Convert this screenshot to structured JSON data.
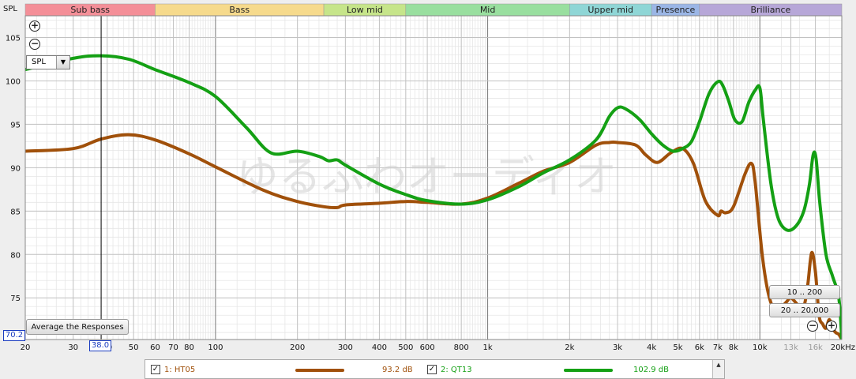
{
  "header": {
    "spl_label": "SPL"
  },
  "controls": {
    "spl_selected": "SPL",
    "average_button": "Average the Responses",
    "range_10_200": "10 .. 200",
    "range_20_20000": "20 .. 20,000",
    "cursor_freq": "38.0",
    "cursor_level": "70.2"
  },
  "bands": [
    {
      "name": "Sub bass",
      "from": 20,
      "to": 60,
      "color": "#f48f98"
    },
    {
      "name": "Bass",
      "from": 60,
      "to": 250,
      "color": "#f6da8c"
    },
    {
      "name": "Low mid",
      "from": 250,
      "to": 500,
      "color": "#c6e58a"
    },
    {
      "name": "Mid",
      "from": 500,
      "to": 2000,
      "color": "#99df9f"
    },
    {
      "name": "Upper mid",
      "from": 2000,
      "to": 4000,
      "color": "#8fd6d6"
    },
    {
      "name": "Presence",
      "from": 4000,
      "to": 6000,
      "color": "#9bb6e6"
    },
    {
      "name": "Brilliance",
      "from": 6000,
      "to": 20000,
      "color": "#b7a7d8"
    }
  ],
  "legend": [
    {
      "index": "1: HT05",
      "level": "93.2 dB",
      "color": "#a0500a"
    },
    {
      "index": "2: QT13",
      "level": "102.9 dB",
      "color": "#14a014"
    }
  ],
  "watermark": "ゆるふわオーディオ",
  "chart_data": {
    "type": "line",
    "xlabel": "",
    "ylabel": "SPL",
    "xscale": "log",
    "xlim": [
      20,
      20000
    ],
    "ylim": [
      70.2,
      107.5
    ],
    "grid": true,
    "cursor_x": 38,
    "x_ticks": [
      {
        "v": 20,
        "t": "20"
      },
      {
        "v": 30,
        "t": "30"
      },
      {
        "v": 40,
        "t": "40"
      },
      {
        "v": 50,
        "t": "50"
      },
      {
        "v": 60,
        "t": "60"
      },
      {
        "v": 70,
        "t": "70"
      },
      {
        "v": 80,
        "t": "80"
      },
      {
        "v": 100,
        "t": "100"
      },
      {
        "v": 200,
        "t": "200"
      },
      {
        "v": 300,
        "t": "300"
      },
      {
        "v": 400,
        "t": "400"
      },
      {
        "v": 500,
        "t": "500"
      },
      {
        "v": 600,
        "t": "600"
      },
      {
        "v": 800,
        "t": "800"
      },
      {
        "v": 1000,
        "t": "1k"
      },
      {
        "v": 2000,
        "t": "2k"
      },
      {
        "v": 3000,
        "t": "3k"
      },
      {
        "v": 4000,
        "t": "4k"
      },
      {
        "v": 5000,
        "t": "5k"
      },
      {
        "v": 6000,
        "t": "6k"
      },
      {
        "v": 7000,
        "t": "7k"
      },
      {
        "v": 8000,
        "t": "8k"
      },
      {
        "v": 10000,
        "t": "10k"
      },
      {
        "v": 13000,
        "t": "13k"
      },
      {
        "v": 16000,
        "t": "16k"
      },
      {
        "v": 20000,
        "t": "20kHz"
      }
    ],
    "y_ticks": [
      75,
      80,
      85,
      90,
      95,
      100,
      105
    ],
    "series": [
      {
        "name": "1: HT05",
        "color": "#a0500a",
        "x": [
          20,
          30,
          38,
          48,
          60,
          80,
          100,
          150,
          200,
          250,
          280,
          300,
          400,
          500,
          600,
          800,
          1000,
          1300,
          1600,
          2000,
          2500,
          2800,
          3000,
          3500,
          3800,
          4200,
          4700,
          5200,
          5700,
          6300,
          7000,
          7200,
          7500,
          8000,
          8800,
          9300,
          9600,
          10200,
          10800,
          11500,
          12500,
          13000,
          13800,
          14500,
          15000,
          15500,
          16000,
          16500,
          17000,
          17500,
          18000,
          18500,
          19000,
          19500,
          20000
        ],
        "y": [
          91.9,
          92.2,
          93.3,
          93.8,
          93.2,
          91.6,
          90.1,
          87.4,
          86.1,
          85.5,
          85.4,
          85.7,
          85.9,
          86.1,
          86.0,
          85.8,
          86.5,
          88.2,
          89.6,
          90.6,
          92.6,
          92.9,
          92.9,
          92.6,
          91.5,
          90.6,
          91.7,
          92.2,
          90.5,
          86.2,
          84.5,
          85.0,
          84.8,
          85.5,
          89.2,
          90.5,
          88.5,
          80.0,
          75.2,
          73.5,
          74.5,
          75.0,
          74.2,
          74.0,
          76.5,
          80.2,
          78.0,
          73.0,
          72.0,
          71.5,
          72.5,
          71.5,
          71.0,
          70.8,
          70.2
        ]
      },
      {
        "name": "2: QT13",
        "color": "#14a014",
        "x": [
          20,
          30,
          38,
          48,
          60,
          80,
          100,
          130,
          160,
          200,
          240,
          260,
          280,
          300,
          400,
          500,
          600,
          800,
          1000,
          1300,
          1600,
          2000,
          2500,
          2800,
          3000,
          3200,
          3600,
          4000,
          4400,
          4800,
          5200,
          5600,
          6000,
          6500,
          7000,
          7300,
          7700,
          8100,
          8600,
          9100,
          9600,
          10000,
          10300,
          11000,
          11700,
          12600,
          13600,
          14500,
          15200,
          15700,
          16100,
          16600,
          17500,
          18500,
          19500,
          20000
        ],
        "y": [
          101.3,
          102.6,
          102.9,
          102.5,
          101.3,
          99.8,
          98.2,
          94.6,
          91.7,
          91.9,
          91.3,
          90.8,
          90.9,
          90.3,
          88.1,
          86.9,
          86.2,
          85.8,
          86.3,
          87.8,
          89.4,
          90.9,
          93.2,
          95.9,
          96.9,
          96.8,
          95.6,
          93.9,
          92.6,
          91.9,
          92.2,
          93.0,
          95.3,
          98.5,
          99.9,
          99.5,
          97.6,
          95.5,
          95.3,
          97.5,
          98.9,
          99.2,
          95.5,
          88.0,
          84.1,
          82.8,
          83.3,
          85.0,
          88.0,
          91.5,
          91.0,
          86.0,
          80.0,
          77.5,
          75.0,
          70.2
        ]
      }
    ]
  }
}
